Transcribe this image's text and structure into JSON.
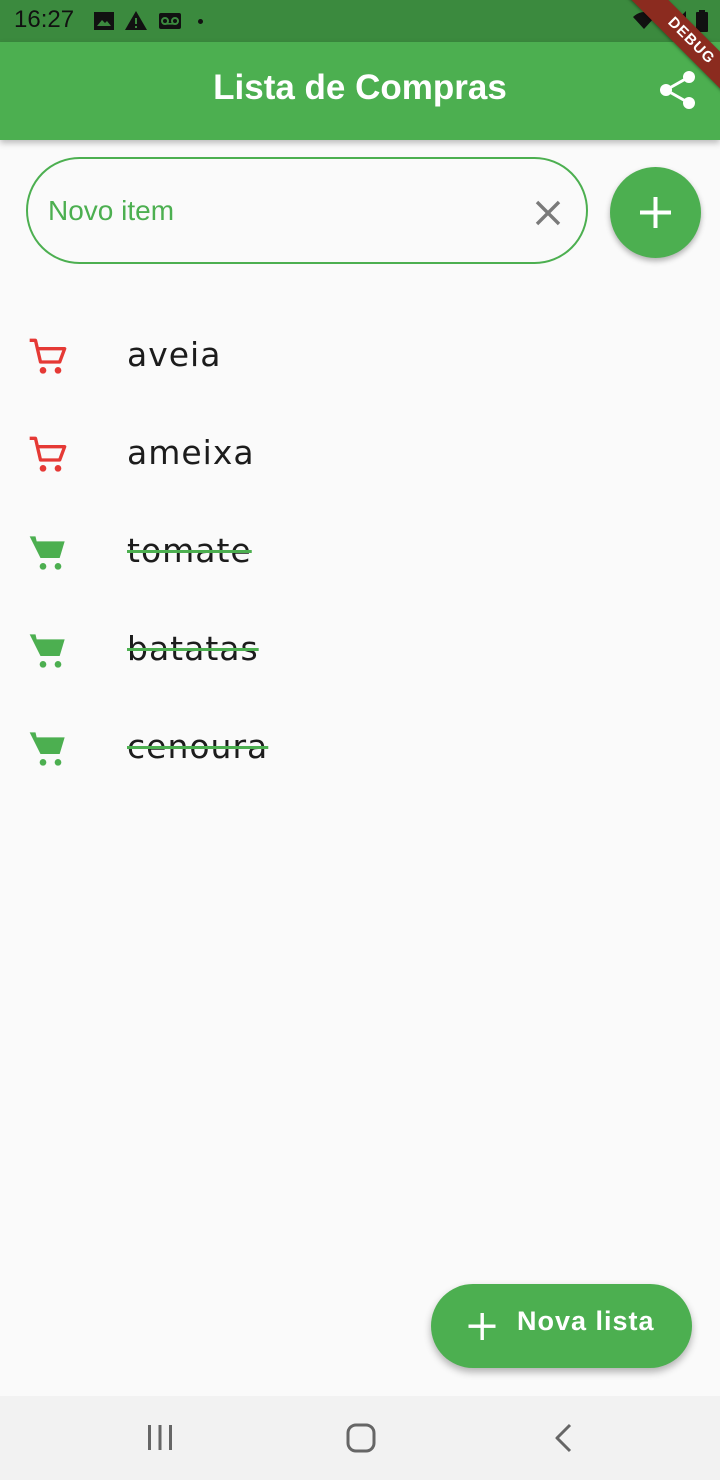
{
  "status_bar": {
    "time": "16:27",
    "icons": [
      "image-icon",
      "warning-icon",
      "voicemail-icon",
      "wifi-icon",
      "signal-icon",
      "battery-icon"
    ]
  },
  "debug_banner": "DEBUG",
  "app_bar": {
    "title": "Lista de Compras",
    "share_icon": "share-icon"
  },
  "new_item": {
    "placeholder": "Novo item",
    "value": "",
    "clear_icon": "close-icon",
    "add_icon": "plus-icon"
  },
  "items": [
    {
      "label": "aveia",
      "done": false
    },
    {
      "label": "ameixa",
      "done": false
    },
    {
      "label": "tomate",
      "done": true
    },
    {
      "label": "batatas",
      "done": true
    },
    {
      "label": "cenoura",
      "done": true
    }
  ],
  "fab": {
    "label": "Nova lista",
    "icon": "plus-icon"
  },
  "nav_bar": {
    "icons": [
      "recent-apps-icon",
      "home-icon",
      "back-icon"
    ]
  },
  "colors": {
    "primary": "#4caf50",
    "status_bar": "#3b8a3e",
    "pending": "#e53935",
    "done": "#4caf50",
    "text": "#1c1c1c"
  }
}
